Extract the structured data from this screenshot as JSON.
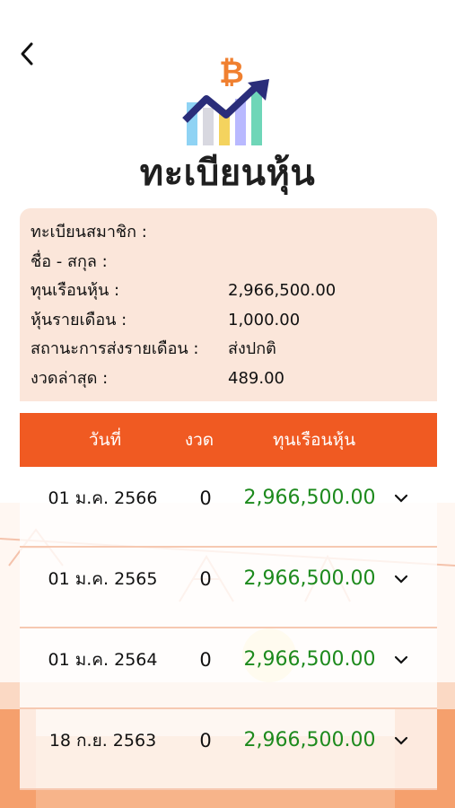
{
  "header": {
    "title": "ทะเบียนหุ้น",
    "back_icon": "chevron-left-icon",
    "logo_icon": "bitcoin-growth-chart-icon"
  },
  "member_info": {
    "member_id_label": "ทะเบียนสมาชิก :",
    "member_id_value": "",
    "name_label": "ชื่อ - สกุล :",
    "name_value": "",
    "share_capital_label": "ทุนเรือนหุ้น :",
    "share_capital_value": "2,966,500.00",
    "monthly_share_label": "หุ้นรายเดือน :",
    "monthly_share_value": "1,000.00",
    "monthly_status_label": "สถานะการส่งรายเดือน :",
    "monthly_status_value": "ส่งปกติ",
    "latest_period_label": "งวดล่าสุด :",
    "latest_period_value": "489.00"
  },
  "table": {
    "headers": [
      "วันที่",
      "งวด",
      "ทุนเรือนหุ้น"
    ],
    "rows": [
      {
        "date": "01 ม.ค. 2566",
        "period": "0",
        "amount": "2,966,500.00"
      },
      {
        "date": "01 ม.ค. 2565",
        "period": "0",
        "amount": "2,966,500.00"
      },
      {
        "date": "01 ม.ค. 2564",
        "period": "0",
        "amount": "2,966,500.00"
      },
      {
        "date": "18 ก.ย. 2563",
        "period": "0",
        "amount": "2,966,500.00"
      }
    ]
  },
  "colors": {
    "accent": "#f05a22",
    "card_bg": "#fbe6da",
    "amount_green": "#1d8a1d"
  }
}
